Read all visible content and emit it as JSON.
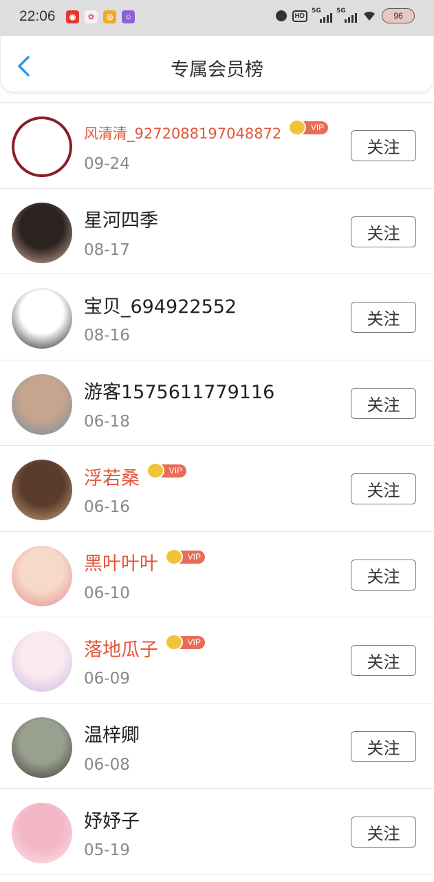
{
  "status_bar": {
    "time": "22:06",
    "apps": [
      {
        "icon": "netease-music-icon",
        "color": "#e03a2f",
        "glyph": "◉"
      },
      {
        "icon": "photo-app-icon",
        "color": "#f2f2f2",
        "glyph": "✿"
      },
      {
        "icon": "weibo-icon",
        "color": "#f5a623",
        "glyph": "◎"
      },
      {
        "icon": "purple-app-icon",
        "color": "#8a63d2",
        "glyph": "☺"
      }
    ],
    "hd_label": "HD",
    "signal1_label": "5G",
    "signal2_label": "5G",
    "battery": "96"
  },
  "header": {
    "title": "专属会员榜",
    "back_icon": "chevron-left-icon",
    "accent": "#2a9be8"
  },
  "members": [
    {
      "name": "风清清_9272088197048872",
      "date": "09-24",
      "vip": true,
      "follow_label": "关注",
      "avatar_icon": "cartoon-avatar",
      "avatar_colors": [
        "#ffffff",
        "#8c1d2a"
      ]
    },
    {
      "name": "星河四季",
      "date": "08-17",
      "vip": false,
      "follow_label": "关注",
      "avatar_icon": "anime-girl-avatar",
      "avatar_colors": [
        "#2b2320",
        "#d8b49c"
      ]
    },
    {
      "name": "宝贝_694922552",
      "date": "08-16",
      "vip": false,
      "follow_label": "关注",
      "avatar_icon": "qq-penguin-avatar",
      "avatar_colors": [
        "#ffffff",
        "#111111"
      ]
    },
    {
      "name": "游客1575611779116",
      "date": "06-18",
      "vip": false,
      "follow_label": "关注",
      "avatar_icon": "photo-avatar",
      "avatar_colors": [
        "#c7a48e",
        "#6b8fa8"
      ]
    },
    {
      "name": "浮若桑",
      "date": "06-16",
      "vip": true,
      "follow_label": "关注",
      "avatar_icon": "collage-avatar",
      "avatar_colors": [
        "#5a3b2c",
        "#c9a57a"
      ]
    },
    {
      "name": "黑叶叶叶",
      "date": "06-10",
      "vip": true,
      "follow_label": "关注",
      "avatar_icon": "cartoon-face-avatar",
      "avatar_colors": [
        "#f6d9c8",
        "#e7898e"
      ]
    },
    {
      "name": "落地瓜子",
      "date": "06-09",
      "vip": true,
      "follow_label": "关注",
      "avatar_icon": "anime-girl-pink-avatar",
      "avatar_colors": [
        "#fbe9ef",
        "#c7b6e0"
      ]
    },
    {
      "name": "温梓卿",
      "date": "06-08",
      "vip": false,
      "follow_label": "关注",
      "avatar_icon": "portrait-avatar",
      "avatar_colors": [
        "#9aa08f",
        "#3d3a33"
      ]
    },
    {
      "name": "妤妤子",
      "date": "05-19",
      "vip": false,
      "follow_label": "关注",
      "avatar_icon": "plush-toy-avatar",
      "avatar_colors": [
        "#f3b6c6",
        "#fbe4ea"
      ]
    }
  ],
  "vip_label": "VIP"
}
